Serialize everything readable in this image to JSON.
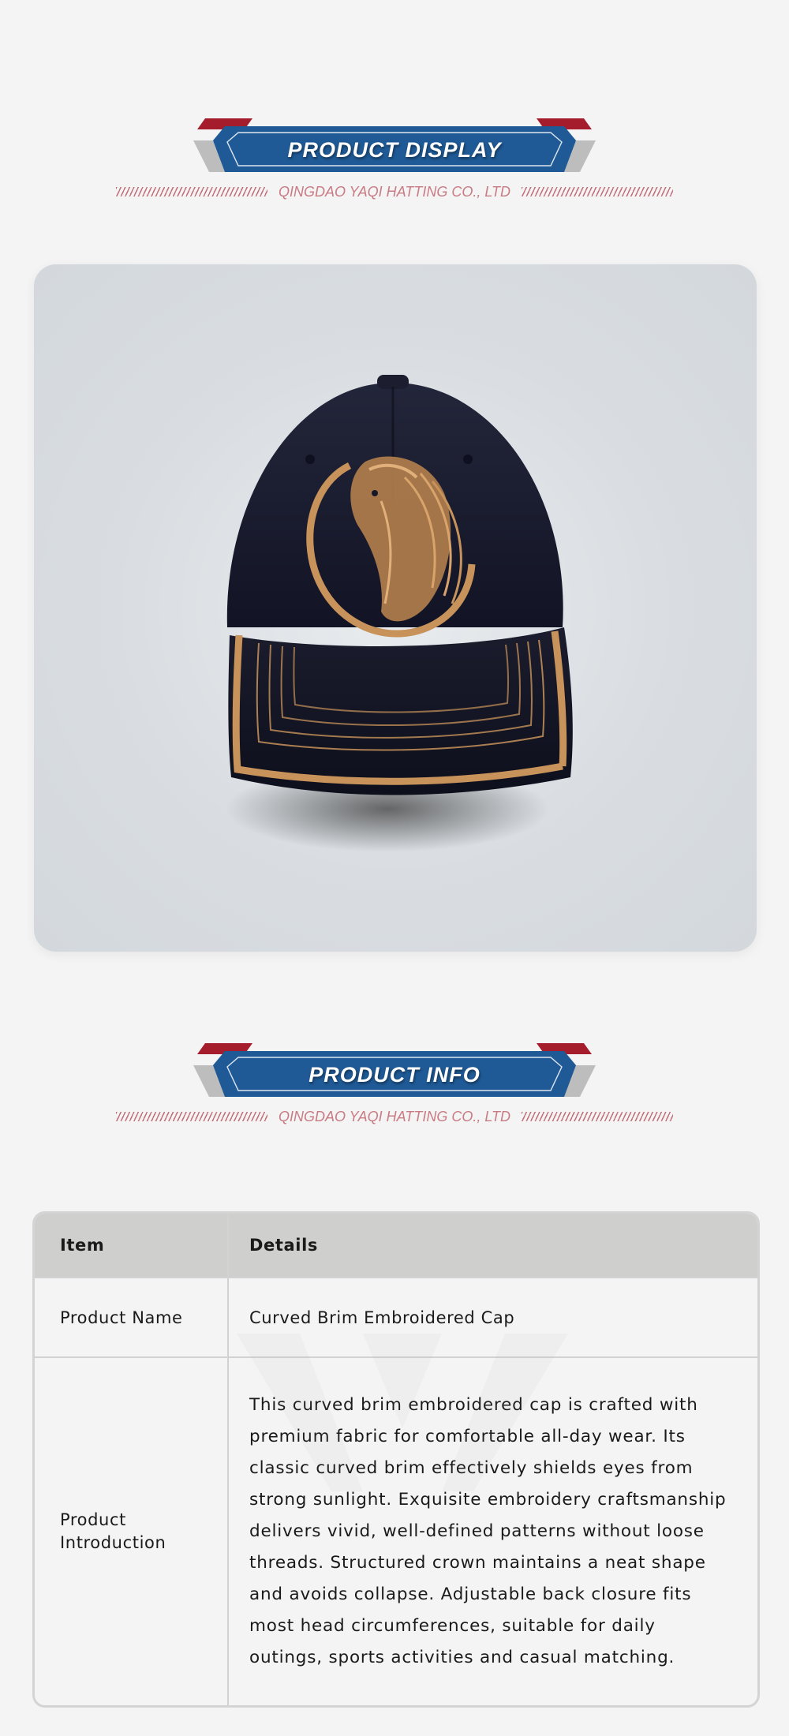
{
  "display_section": {
    "title": "PRODUCT DISPLAY",
    "subtitle": "QINGDAO YAQI HATTING CO., LTD"
  },
  "product_image": {
    "description_icon": "baseball-cap-horse-embroidery",
    "colors": {
      "cap": "#16182a",
      "embroidery": "#c8935a",
      "background": "#d6dbdf"
    }
  },
  "info_section": {
    "title": "PRODUCT INFO",
    "subtitle": "QINGDAO YAQI HATTING CO., LTD"
  },
  "table": {
    "headers": {
      "item": "Item",
      "details": "Details"
    },
    "rows": [
      {
        "item": "Product Name",
        "details": "Curved Brim Embroidered Cap"
      },
      {
        "item": "Product Introduction",
        "details": "This curved brim embroidered cap is crafted with premium fabric for comfortable all-day wear. Its classic curved brim effectively shields eyes from strong sunlight. Exquisite embroidery craftsmanship delivers vivid, well-defined patterns without loose threads. Structured crown maintains a neat shape and avoids collapse. Adjustable back closure fits most head circumferences, suitable for daily outings, sports activities and casual matching."
      }
    ]
  },
  "theme": {
    "banner_blue": "#1f5a96",
    "banner_red": "#a51d2d",
    "banner_gray": "#bdbdbd",
    "accent_pink": "#c97b84"
  }
}
